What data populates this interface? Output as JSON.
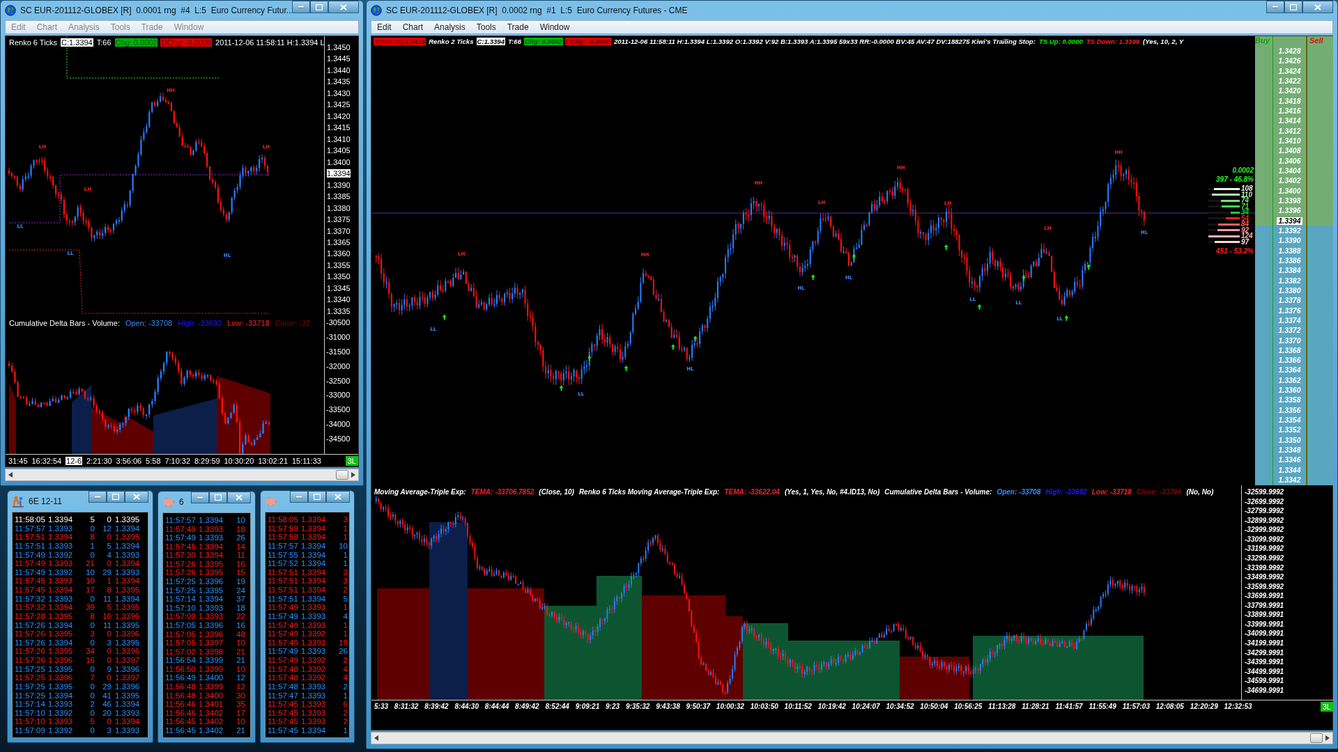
{
  "left_window": {
    "title": "SC EUR-201112-GLOBEX [R]  0.0001 rng  #4  L:5  Euro Currency Futur...",
    "menu": [
      "Edit",
      "Chart",
      "Analysis",
      "Tools",
      "Trade",
      "Window"
    ],
    "info_bar": [
      {
        "text": "Renko 6 Ticks",
        "kind": "plain"
      },
      {
        "text": "C:1.3394",
        "kind": "boxed"
      },
      {
        "text": "T:66",
        "kind": "plain"
      },
      {
        "text": "Chg: 0.0002",
        "kind": "up"
      },
      {
        "text": "DChg: -0.0006",
        "kind": "down"
      },
      {
        "text": "2011-12-06 11:58:11 H:1.3394 L",
        "kind": "plain"
      }
    ],
    "swing_labels": [
      {
        "text": "LH",
        "kind": "high"
      },
      {
        "text": "HH",
        "kind": "high"
      },
      {
        "text": "LH",
        "kind": "high"
      },
      {
        "text": "LL",
        "kind": "low"
      },
      {
        "text": "LL",
        "kind": "low"
      },
      {
        "text": "HL",
        "kind": "low"
      },
      {
        "text": "LH",
        "kind": "high"
      }
    ],
    "price_axis": [
      {
        "text": "1.3450",
        "kind": "tick"
      },
      {
        "text": "1.3445",
        "kind": "tick"
      },
      {
        "text": "1.3440",
        "kind": "tick"
      },
      {
        "text": "1.3435",
        "kind": "tick"
      },
      {
        "text": "1.3430",
        "kind": "tick"
      },
      {
        "text": "1.3425",
        "kind": "tick"
      },
      {
        "text": "1.3420",
        "kind": "tick"
      },
      {
        "text": "1.3415",
        "kind": "tick"
      },
      {
        "text": "1.3410",
        "kind": "tick"
      },
      {
        "text": "1.3405",
        "kind": "tick"
      },
      {
        "text": "1.3400",
        "kind": "tick"
      },
      {
        "text": "1.3394",
        "kind": "current"
      },
      {
        "text": "1.3390",
        "kind": "tick"
      },
      {
        "text": "1.3385",
        "kind": "tick"
      },
      {
        "text": "1.3380",
        "kind": "tick"
      },
      {
        "text": "1.3375",
        "kind": "tick"
      },
      {
        "text": "1.3370",
        "kind": "tick"
      },
      {
        "text": "1.3365",
        "kind": "tick"
      },
      {
        "text": "1.3360",
        "kind": "tick"
      },
      {
        "text": "1.3355",
        "kind": "tick"
      },
      {
        "text": "1.3350",
        "kind": "tick"
      },
      {
        "text": "1.3345",
        "kind": "tick"
      },
      {
        "text": "1.3340",
        "kind": "tick"
      },
      {
        "text": "1.3335",
        "kind": "tick"
      }
    ],
    "lower_header": [
      {
        "text": "Cumulative Delta Bars - Volume:",
        "kind": "plain"
      },
      {
        "text": "Open: -33708",
        "kind": "lightblue"
      },
      {
        "text": "High: -33692",
        "kind": "blue"
      },
      {
        "text": "Low: -33718",
        "kind": "red"
      },
      {
        "text": "Close: -33",
        "kind": "darkred"
      }
    ],
    "lower_axis": [
      "-30500",
      "-31000",
      "-31500",
      "-32000",
      "-32500",
      "-33000",
      "-33500",
      "-34000",
      "-34500"
    ],
    "time_axis": [
      {
        "text": "31:45",
        "kind": "time"
      },
      {
        "text": "16:32:54",
        "kind": "time"
      },
      {
        "text": "12-6",
        "kind": "date"
      },
      {
        "text": "2:21:30",
        "kind": "time"
      },
      {
        "text": "3:56:06",
        "kind": "time"
      },
      {
        "text": "5:58",
        "kind": "time"
      },
      {
        "text": "7:10:32",
        "kind": "time"
      },
      {
        "text": "8:29:59",
        "kind": "time"
      },
      {
        "text": "10:30:20",
        "kind": "time"
      },
      {
        "text": "13:02:21",
        "kind": "time"
      },
      {
        "text": "15:11:33",
        "kind": "time"
      }
    ],
    "status_badge": "3L"
  },
  "tape_windows": [
    {
      "title": "6E 12-11",
      "rows": [
        {
          "cells": [
            "11:58:05",
            "1.3394",
            "5",
            "0",
            "1.3395"
          ],
          "kind": "last"
        },
        {
          "cells": [
            "11:57:57",
            "1.3393",
            "0",
            "12",
            "1.3394"
          ],
          "kind": "buy"
        },
        {
          "cells": [
            "11:57:51",
            "1.3394",
            "8",
            "0",
            "1.3395"
          ],
          "kind": "sell"
        },
        {
          "cells": [
            "11:57:51",
            "1.3393",
            "1",
            "5",
            "1.3394"
          ],
          "kind": "buy"
        },
        {
          "cells": [
            "11:57:49",
            "1.3392",
            "0",
            "4",
            "1.3393"
          ],
          "kind": "buy"
        },
        {
          "cells": [
            "11:57:49",
            "1.3393",
            "21",
            "0",
            "1.3394"
          ],
          "kind": "sell"
        },
        {
          "cells": [
            "11:57:49",
            "1.3392",
            "10",
            "29",
            "1.3393"
          ],
          "kind": "buy"
        },
        {
          "cells": [
            "11:57:45",
            "1.3393",
            "10",
            "1",
            "1.3394"
          ],
          "kind": "sell"
        },
        {
          "cells": [
            "11:57:45",
            "1.3394",
            "17",
            "8",
            "1.3395"
          ],
          "kind": "sell"
        },
        {
          "cells": [
            "11:57:32",
            "1.3393",
            "0",
            "11",
            "1.3394"
          ],
          "kind": "buy"
        },
        {
          "cells": [
            "11:57:32",
            "1.3394",
            "39",
            "5",
            "1.3395"
          ],
          "kind": "sell"
        },
        {
          "cells": [
            "11:57:28",
            "1.3395",
            "8",
            "16",
            "1.3396"
          ],
          "kind": "sell"
        },
        {
          "cells": [
            "11:57:26",
            "1.3394",
            "0",
            "11",
            "1.3395"
          ],
          "kind": "buy"
        },
        {
          "cells": [
            "11:57:26",
            "1.3395",
            "3",
            "0",
            "1.3396"
          ],
          "kind": "sell"
        },
        {
          "cells": [
            "11:57:26",
            "1.3394",
            "0",
            "3",
            "1.3395"
          ],
          "kind": "buy"
        },
        {
          "cells": [
            "11:57:26",
            "1.3395",
            "34",
            "0",
            "1.3396"
          ],
          "kind": "sell"
        },
        {
          "cells": [
            "11:57:26",
            "1.3396",
            "16",
            "0",
            "1.3397"
          ],
          "kind": "sell"
        },
        {
          "cells": [
            "11:57:25",
            "1.3395",
            "0",
            "9",
            "1.3396"
          ],
          "kind": "buy"
        },
        {
          "cells": [
            "11:57:25",
            "1.3396",
            "7",
            "0",
            "1.3397"
          ],
          "kind": "sell"
        },
        {
          "cells": [
            "11:57:25",
            "1.3395",
            "0",
            "29",
            "1.3396"
          ],
          "kind": "buy"
        },
        {
          "cells": [
            "11:57:25",
            "1.3394",
            "0",
            "41",
            "1.3395"
          ],
          "kind": "buy"
        },
        {
          "cells": [
            "11:57:14",
            "1.3393",
            "2",
            "46",
            "1.3394"
          ],
          "kind": "buy"
        },
        {
          "cells": [
            "11:57:10",
            "1.3392",
            "0",
            "20",
            "1.3393"
          ],
          "kind": "buy"
        },
        {
          "cells": [
            "11:57:10",
            "1.3393",
            "5",
            "0",
            "1.3394"
          ],
          "kind": "sell"
        },
        {
          "cells": [
            "11:57:09",
            "1.3392",
            "0",
            "3",
            "1.3393"
          ],
          "kind": "buy"
        }
      ]
    },
    {
      "title": "6",
      "rows": [
        {
          "cells": [
            "11:57:57",
            "1.3394",
            "10"
          ],
          "kind": "buy"
        },
        {
          "cells": [
            "11:57:49",
            "1.3393",
            "18"
          ],
          "kind": "sell"
        },
        {
          "cells": [
            "11:57:49",
            "1.3393",
            "26"
          ],
          "kind": "buy"
        },
        {
          "cells": [
            "11:57:45",
            "1.3394",
            "14"
          ],
          "kind": "sell"
        },
        {
          "cells": [
            "11:57:30",
            "1.3394",
            "11"
          ],
          "kind": "sell"
        },
        {
          "cells": [
            "11:57:26",
            "1.3395",
            "16"
          ],
          "kind": "sell"
        },
        {
          "cells": [
            "11:57:26",
            "1.3395",
            "15"
          ],
          "kind": "sell"
        },
        {
          "cells": [
            "11:57:25",
            "1.3396",
            "19"
          ],
          "kind": "buy"
        },
        {
          "cells": [
            "11:57:25",
            "1.3395",
            "24"
          ],
          "kind": "buy"
        },
        {
          "cells": [
            "11:57:14",
            "1.3394",
            "37"
          ],
          "kind": "buy"
        },
        {
          "cells": [
            "11:57:10",
            "1.3393",
            "18"
          ],
          "kind": "buy"
        },
        {
          "cells": [
            "11:57:09",
            "1.3393",
            "22"
          ],
          "kind": "sell"
        },
        {
          "cells": [
            "11:57:05",
            "1.3396",
            "16"
          ],
          "kind": "buy"
        },
        {
          "cells": [
            "11:57:05",
            "1.3396",
            "48"
          ],
          "kind": "sell"
        },
        {
          "cells": [
            "11:57:05",
            "1.3397",
            "10"
          ],
          "kind": "sell"
        },
        {
          "cells": [
            "11:57:02",
            "1.3398",
            "21"
          ],
          "kind": "sell"
        },
        {
          "cells": [
            "11:56:54",
            "1.3399",
            "21"
          ],
          "kind": "buy"
        },
        {
          "cells": [
            "11:56:50",
            "1.3399",
            "10"
          ],
          "kind": "sell"
        },
        {
          "cells": [
            "11:56:49",
            "1.3400",
            "12"
          ],
          "kind": "buy"
        },
        {
          "cells": [
            "11:56:48",
            "1.3399",
            "12"
          ],
          "kind": "sell"
        },
        {
          "cells": [
            "11:56:48",
            "1.3400",
            "30"
          ],
          "kind": "sell"
        },
        {
          "cells": [
            "11:56:46",
            "1.3401",
            "35"
          ],
          "kind": "sell"
        },
        {
          "cells": [
            "11:56:46",
            "1.3402",
            "17"
          ],
          "kind": "sell"
        },
        {
          "cells": [
            "11:56:45",
            "1.3402",
            "10"
          ],
          "kind": "sell"
        },
        {
          "cells": [
            "11:56:45",
            "1.3402",
            "21"
          ],
          "kind": "buy"
        }
      ]
    },
    {
      "rows": [
        {
          "cells": [
            "11:58:05",
            "1.3394",
            "3"
          ],
          "kind": "sell"
        },
        {
          "cells": [
            "11:57:59",
            "1.3394",
            "1"
          ],
          "kind": "sell"
        },
        {
          "cells": [
            "11:57:58",
            "1.3394",
            "1"
          ],
          "kind": "sell"
        },
        {
          "cells": [
            "11:57:57",
            "1.3394",
            "10"
          ],
          "kind": "buy"
        },
        {
          "cells": [
            "11:57:55",
            "1.3394",
            "1"
          ],
          "kind": "buy"
        },
        {
          "cells": [
            "11:57:52",
            "1.3394",
            "1"
          ],
          "kind": "buy"
        },
        {
          "cells": [
            "11:57:51",
            "1.3394",
            "3"
          ],
          "kind": "sell"
        },
        {
          "cells": [
            "11:57:51",
            "1.3394",
            "3"
          ],
          "kind": "sell"
        },
        {
          "cells": [
            "11:57:51",
            "1.3394",
            "2"
          ],
          "kind": "sell"
        },
        {
          "cells": [
            "11:57:51",
            "1.3394",
            "5"
          ],
          "kind": "buy"
        },
        {
          "cells": [
            "11:57:49",
            "1.3393",
            "1"
          ],
          "kind": "sell"
        },
        {
          "cells": [
            "11:57:49",
            "1.3393",
            "4"
          ],
          "kind": "buy"
        },
        {
          "cells": [
            "11:57:49",
            "1.3393",
            "1"
          ],
          "kind": "sell"
        },
        {
          "cells": [
            "11:57:49",
            "1.3392",
            "1"
          ],
          "kind": "sell"
        },
        {
          "cells": [
            "11:57:49",
            "1.3393",
            "19"
          ],
          "kind": "sell"
        },
        {
          "cells": [
            "11:57:49",
            "1.3393",
            "26"
          ],
          "kind": "buy"
        },
        {
          "cells": [
            "11:57:49",
            "1.3392",
            "2"
          ],
          "kind": "sell"
        },
        {
          "cells": [
            "11:57:48",
            "1.3392",
            "4"
          ],
          "kind": "sell"
        },
        {
          "cells": [
            "11:57:48",
            "1.3392",
            "4"
          ],
          "kind": "sell"
        },
        {
          "cells": [
            "11:57:48",
            "1.3393",
            "2"
          ],
          "kind": "buy"
        },
        {
          "cells": [
            "11:57:47",
            "1.3393",
            "1"
          ],
          "kind": "buy"
        },
        {
          "cells": [
            "11:57:45",
            "1.3393",
            "6"
          ],
          "kind": "sell"
        },
        {
          "cells": [
            "11:57:45",
            "1.3393",
            "2"
          ],
          "kind": "sell"
        },
        {
          "cells": [
            "11:57:45",
            "1.3393",
            "2"
          ],
          "kind": "sell"
        },
        {
          "cells": [
            "11:57:45",
            "1.3394",
            "1"
          ],
          "kind": "buy"
        }
      ]
    }
  ],
  "right_window": {
    "title": "SC EUR-201112-GLOBEX [R]  0.0002 rng  #1  L:5  Euro Currency Futures - CME",
    "menu": [
      "Edit",
      "Chart",
      "Analysis",
      "Tools",
      "Trade",
      "Window"
    ],
    "info_bar": [
      {
        "text": "Trade:2@1.3416",
        "kind": "alert"
      },
      {
        "text": "Renko 2 Ticks",
        "kind": "plain"
      },
      {
        "text": "C:1.3394",
        "kind": "boxed"
      },
      {
        "text": "T:66",
        "kind": "plain"
      },
      {
        "text": "Chg: 0.0002",
        "kind": "up"
      },
      {
        "text": "DChg: -0.0006",
        "kind": "down"
      },
      {
        "text": "2011-12-06 11:58:11 H:1.3394 L:1.3392 O:1.3392 V:92 B:1.3393 A:1.3395 59x33 RR:-0.0000 BV:45 AV:47 DV:188275 Kiwi's Trailing Stop:",
        "kind": "plain"
      },
      {
        "text": "TS Up: 0.0000",
        "kind": "green"
      },
      {
        "text": "TS Down: 1.3399",
        "kind": "red"
      },
      {
        "text": "(Yes, 10, 2, Y",
        "kind": "plain"
      }
    ],
    "swing_labels": [
      {
        "text": "LH",
        "kind": "high"
      },
      {
        "text": "LL",
        "kind": "low"
      },
      {
        "text": "LL",
        "kind": "low"
      },
      {
        "text": "HH",
        "kind": "high"
      },
      {
        "text": "HL",
        "kind": "low"
      },
      {
        "text": "HH",
        "kind": "high"
      },
      {
        "text": "LH",
        "kind": "high"
      },
      {
        "text": "HL",
        "kind": "low"
      },
      {
        "text": "HL",
        "kind": "low"
      },
      {
        "text": "HH",
        "kind": "high"
      },
      {
        "text": "LH",
        "kind": "high"
      },
      {
        "text": "LL",
        "kind": "low"
      },
      {
        "text": "LL",
        "kind": "low"
      },
      {
        "text": "LH",
        "kind": "high"
      },
      {
        "text": "LL",
        "kind": "low"
      },
      {
        "text": "HH",
        "kind": "high"
      },
      {
        "text": "HL",
        "kind": "low"
      }
    ],
    "volume_profile": {
      "net": "0.0002",
      "buy_total": "397 - 46.8%",
      "sell_total": "451 - 53.2%",
      "bars": [
        {
          "value": "108",
          "level": 0.83,
          "color": "#e8f4e8"
        },
        {
          "value": "110",
          "level": 0.88,
          "color": "#b0f0b0"
        },
        {
          "value": "74",
          "level": 0.6,
          "color": "#70e870"
        },
        {
          "value": "71",
          "level": 0.57,
          "color": "#40e040"
        },
        {
          "value": "34",
          "level": 0.29,
          "color": "#20d020"
        },
        {
          "value": "54",
          "level": 0.45,
          "color": "#ff2020"
        },
        {
          "value": "84",
          "level": 0.69,
          "color": "#ff6060"
        },
        {
          "value": "92",
          "level": 0.71,
          "color": "#ff9898"
        },
        {
          "value": "124",
          "level": 1.0,
          "color": "#ffb0b0"
        },
        {
          "value": "97",
          "level": 0.79,
          "color": "#ffd8d8"
        }
      ]
    },
    "price_ladder": {
      "buy_label": "Buy",
      "sell_label": "Sell",
      "rows": [
        {
          "price": "1.3428",
          "kind": "ask"
        },
        {
          "price": "1.3426",
          "kind": "ask"
        },
        {
          "price": "1.3424",
          "kind": "ask"
        },
        {
          "price": "1.3422",
          "kind": "ask"
        },
        {
          "price": "1.3420",
          "kind": "ask"
        },
        {
          "price": "1.3418",
          "kind": "ask"
        },
        {
          "price": "1.3416",
          "kind": "ask"
        },
        {
          "price": "1.3414",
          "kind": "ask"
        },
        {
          "price": "1.3412",
          "kind": "ask"
        },
        {
          "price": "1.3410",
          "kind": "ask"
        },
        {
          "price": "1.3408",
          "kind": "ask"
        },
        {
          "price": "1.3406",
          "kind": "ask"
        },
        {
          "price": "1.3404",
          "kind": "ask"
        },
        {
          "price": "1.3402",
          "kind": "ask"
        },
        {
          "price": "1.3400",
          "kind": "ask"
        },
        {
          "price": "1.3398",
          "kind": "ask"
        },
        {
          "price": "1.3396",
          "kind": "ask"
        },
        {
          "price": "1.3394",
          "kind": "current"
        },
        {
          "price": "1.3392",
          "kind": "bid"
        },
        {
          "price": "1.3390",
          "kind": "bid"
        },
        {
          "price": "1.3388",
          "kind": "bid"
        },
        {
          "price": "1.3386",
          "kind": "bid"
        },
        {
          "price": "1.3384",
          "kind": "bid"
        },
        {
          "price": "1.3382",
          "kind": "bid"
        },
        {
          "price": "1.3380",
          "kind": "bid"
        },
        {
          "price": "1.3378",
          "kind": "bid"
        },
        {
          "price": "1.3376",
          "kind": "bid"
        },
        {
          "price": "1.3374",
          "kind": "bid"
        },
        {
          "price": "1.3372",
          "kind": "bid"
        },
        {
          "price": "1.3370",
          "kind": "bid"
        },
        {
          "price": "1.3368",
          "kind": "bid"
        },
        {
          "price": "1.3366",
          "kind": "bid"
        },
        {
          "price": "1.3364",
          "kind": "bid"
        },
        {
          "price": "1.3362",
          "kind": "bid"
        },
        {
          "price": "1.3360",
          "kind": "bid"
        },
        {
          "price": "1.3358",
          "kind": "bid"
        },
        {
          "price": "1.3356",
          "kind": "bid"
        },
        {
          "price": "1.3354",
          "kind": "bid"
        },
        {
          "price": "1.3352",
          "kind": "bid"
        },
        {
          "price": "1.3350",
          "kind": "bid"
        },
        {
          "price": "1.3348",
          "kind": "bid"
        },
        {
          "price": "1.3346",
          "kind": "bid"
        },
        {
          "price": "1.3344",
          "kind": "bid"
        },
        {
          "price": "1.3342",
          "kind": "bid"
        }
      ]
    },
    "lower_header": [
      {
        "text": "Moving Average-Triple Exp:",
        "kind": "plain"
      },
      {
        "text": "TEMA: -33706.7852",
        "kind": "red"
      },
      {
        "text": "(Close, 10)",
        "kind": "plain"
      },
      {
        "text": "Renko 6 Ticks Moving Average-Triple Exp:",
        "kind": "plain"
      },
      {
        "text": "TEMA: -33622.04",
        "kind": "red"
      },
      {
        "text": "(Yes, 1, Yes, No, #4.ID13, No)",
        "kind": "plain"
      },
      {
        "text": "Cumulative Delta Bars - Volume:",
        "kind": "plain"
      },
      {
        "text": "Open: -33708",
        "kind": "lightblue"
      },
      {
        "text": "High: -33692",
        "kind": "blue"
      },
      {
        "text": "Low: -33718",
        "kind": "red"
      },
      {
        "text": "Close: -33706",
        "kind": "darkred"
      },
      {
        "text": "(No, No)",
        "kind": "plain"
      }
    ],
    "lower_axis": [
      "-32599.9992",
      "-32699.9992",
      "-32799.9992",
      "-32899.9992",
      "-32999.9992",
      "-33099.9992",
      "-33199.9992",
      "-33299.9992",
      "-33399.9992",
      "-33499.9992",
      "-33599.9992",
      "-33699.9991",
      "-33799.9991",
      "-33899.9991",
      "-33999.9991",
      "-34099.9991",
      "-34199.9991",
      "-34299.9991",
      "-34399.9991",
      "-34499.9991",
      "-34599.9991",
      "-34699.9991"
    ],
    "time_axis": [
      "5:33",
      "8:31:32",
      "8:39:42",
      "8:44:30",
      "8:44:44",
      "8:49:42",
      "8:52:44",
      "9:09:21",
      "9:23",
      "9:35:32",
      "9:43:38",
      "9:50:37",
      "10:00:32",
      "10:03:50",
      "10:11:52",
      "10:19:42",
      "10:24:07",
      "10:34:52",
      "10:50:04",
      "10:56:25",
      "11:13:28",
      "11:28:21",
      "11:41:57",
      "11:55:49",
      "11:57:03",
      "12:08:05",
      "12:20:29",
      "12:32:53"
    ],
    "status_badge": "3L"
  }
}
